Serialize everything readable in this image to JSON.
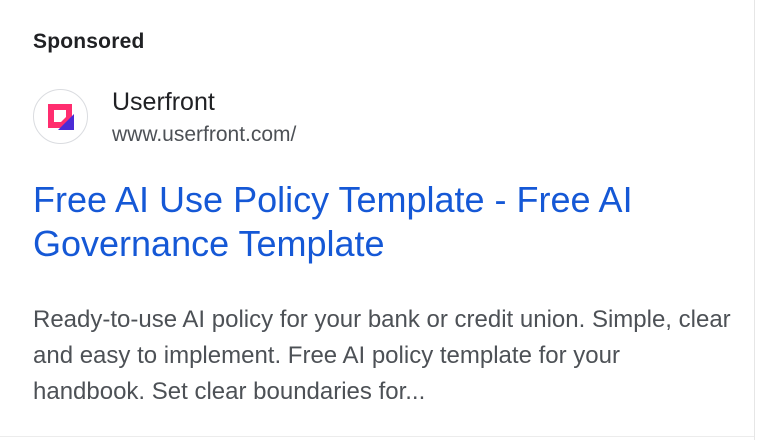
{
  "ad": {
    "sponsored_label": "Sponsored",
    "advertiser": {
      "name": "Userfront",
      "url": "www.userfront.com/",
      "icon": "userfront-logo-icon"
    },
    "headline": "Free AI Use Policy Template - Free AI Governance Template",
    "description": "Ready-to-use AI policy for your bank or credit union. Simple, clear and easy to implement. Free AI policy template for your handbook. Set clear boundaries for..."
  },
  "colors": {
    "link": "#1558d6",
    "text": "#202124",
    "secondary_text": "#4d5156",
    "logo_pink": "#ff2d6f",
    "logo_purple": "#4b2bd6"
  }
}
